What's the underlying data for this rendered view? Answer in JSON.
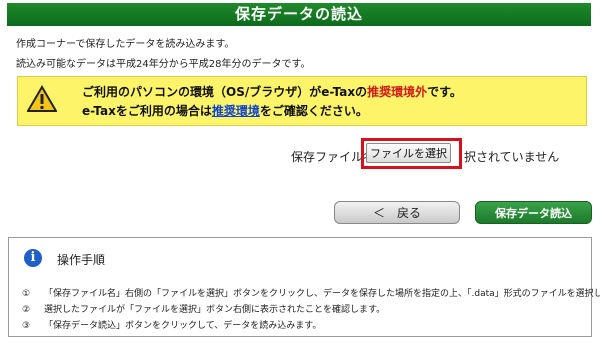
{
  "header": {
    "title": "保存データの読込"
  },
  "intro": {
    "line1": "作成コーナーで保存したデータを読み込みます。",
    "line2": "読込み可能なデータは平成24年分から平成28年分のデータです。"
  },
  "warning": {
    "line1_part1": "ご利用のパソコンの環境（OS/ブラウザ）がe-Taxの",
    "line1_highlight": "推奨環境外",
    "line1_part2": "です。",
    "line2_part1": "e-Taxをご利用の場合は",
    "line2_link": "推奨環境",
    "line2_part2": "をご確認ください。",
    "icon": "warning-triangle-icon"
  },
  "file": {
    "label": "保存ファイル名",
    "button_label": "ファイルを選択",
    "status": "択されていません"
  },
  "actions": {
    "back_label": "＜　戻る",
    "read_label": "保存データ読込"
  },
  "help": {
    "title": "操作手順",
    "icon": "info-icon",
    "steps": [
      {
        "num": "①",
        "text": "「保存ファイル名」右側の「ファイルを選択」ボタンをクリックし、データを保存した場所を指定の上、「.data」形式のファイルを選択します。"
      },
      {
        "num": "②",
        "text": "選択したファイルが「ファイルを選択」ボタン右側に表示されたことを確認します。"
      },
      {
        "num": "③",
        "text": "「保存データ読込」ボタンをクリックして、データを読み込みます。"
      }
    ]
  },
  "colors": {
    "header_green": "#0d6a1c",
    "warning_yellow": "#fdf46a",
    "highlight_red": "#d6101c"
  }
}
